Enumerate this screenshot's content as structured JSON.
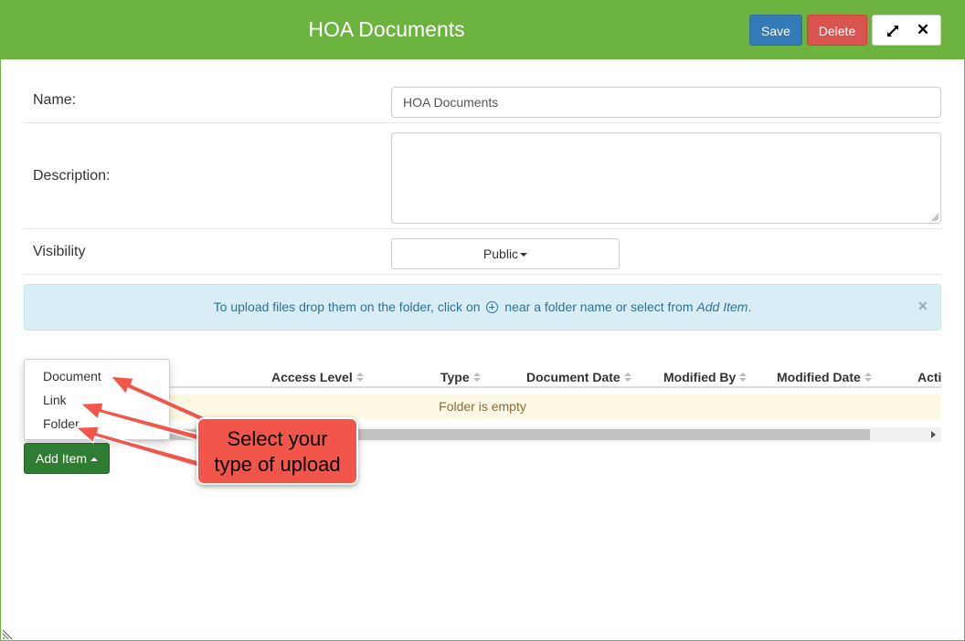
{
  "header": {
    "title": "HOA Documents",
    "save_label": "Save",
    "delete_label": "Delete",
    "close_glyph": "✕",
    "colors": {
      "header_bg": "#6db33f",
      "save": "#337ab7",
      "delete": "#d9534f"
    }
  },
  "form": {
    "name_label": "Name:",
    "name_value": "HOA Documents",
    "description_label": "Description:",
    "description_value": "",
    "visibility_label": "Visibility",
    "visibility_value": "Public"
  },
  "alert": {
    "text_before": "To upload files drop them on the folder, click on",
    "text_middle": "near a folder name or select from",
    "text_emphasis": "Add Item",
    "text_end": ".",
    "close_glyph": "×"
  },
  "table": {
    "columns": [
      "Access Level",
      "Type",
      "Document Date",
      "Modified By",
      "Modified Date",
      "Acti"
    ],
    "empty_message": "Folder is empty"
  },
  "add_menu": {
    "button_label": "Add Item",
    "items": [
      "Document",
      "Link",
      "Folder"
    ]
  },
  "annotation": {
    "line1": "Select your",
    "line2": "type of upload",
    "color": "#f2564a"
  },
  "icons": [
    "expand-icon",
    "close-icon",
    "plus-circle-icon",
    "sort-icon",
    "caret-down-icon",
    "caret-up-icon"
  ]
}
